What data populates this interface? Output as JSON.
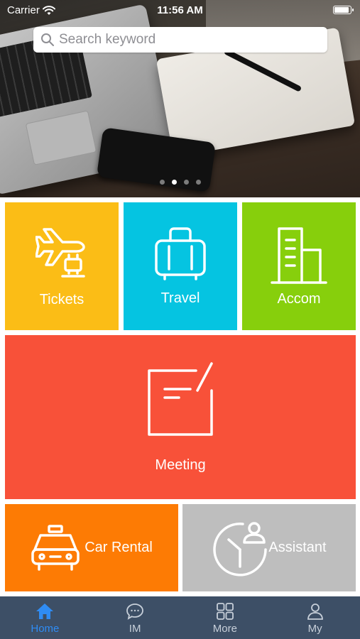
{
  "status_bar": {
    "carrier": "Carrier",
    "time": "11:56 AM"
  },
  "search": {
    "placeholder": "Search keyword"
  },
  "carousel": {
    "page_count": 4,
    "active_index": 1
  },
  "tiles": {
    "tickets": {
      "label": "Tickets",
      "color": "#fbbd16",
      "icon": "plane-luggage-icon"
    },
    "travel": {
      "label": "Travel",
      "color": "#05c4e1",
      "icon": "suitcase-icon"
    },
    "accom": {
      "label": "Accom",
      "color": "#87cf0c",
      "icon": "building-icon"
    },
    "meeting": {
      "label": "Meeting",
      "color": "#f85139",
      "icon": "edit-note-icon"
    },
    "car_rental": {
      "label": "Car Rental",
      "color": "#fd7b04",
      "icon": "taxi-icon"
    },
    "assistant": {
      "label": "Assistant",
      "color": "#bebebe",
      "icon": "clock-person-icon"
    }
  },
  "tab_bar": {
    "active_color": "#2f8cf4",
    "items": [
      {
        "label": "Home",
        "icon": "home-icon",
        "active": true
      },
      {
        "label": "IM",
        "icon": "chat-icon",
        "active": false
      },
      {
        "label": "More",
        "icon": "grid-icon",
        "active": false
      },
      {
        "label": "My",
        "icon": "person-icon",
        "active": false
      }
    ]
  }
}
